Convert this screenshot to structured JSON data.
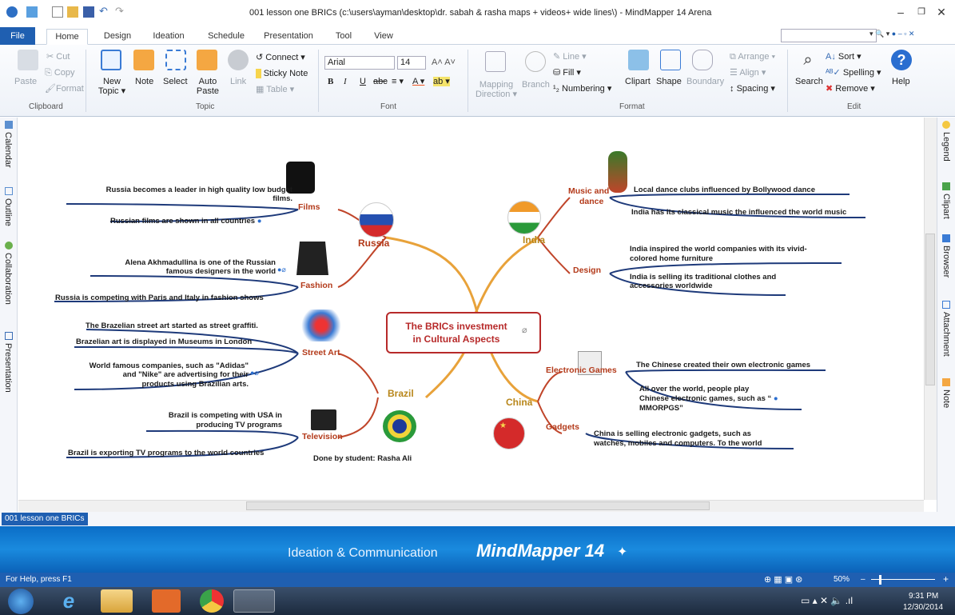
{
  "window": {
    "title": "001 lesson one BRICs (c:\\users\\ayman\\desktop\\dr. sabah & rasha maps + videos+ wide lines\\) - MindMapper 14 Arena"
  },
  "tabs": [
    "Home",
    "Design",
    "Ideation",
    "Schedule",
    "Presentation",
    "Tool",
    "View"
  ],
  "file_tab": "File",
  "ribbon": {
    "clipboard": {
      "paste": "Paste",
      "cut": "Cut",
      "copy": "Copy",
      "format": "Format",
      "label": "Clipboard"
    },
    "topic": {
      "new_topic": "New Topic ▾",
      "note": "Note",
      "select": "Select",
      "auto_paste": "Auto Paste",
      "link": "Link",
      "connect": "Connect ▾",
      "sticky_note": "Sticky Note",
      "table": "Table ▾",
      "label": "Topic"
    },
    "font": {
      "family": "Arial",
      "size": "14",
      "label": "Font"
    },
    "format": {
      "mapping_direction": "Mapping Direction ▾",
      "branch": "Branch",
      "line": "Line ▾",
      "fill": "Fill ▾",
      "numbering": "Numbering ▾",
      "clipart": "Clipart",
      "shape": "Shape",
      "boundary": "Boundary",
      "arrange": "Arrange ▾",
      "align": "Align ▾",
      "spacing": "Spacing ▾",
      "label": "Format"
    },
    "edit": {
      "search": "Search",
      "sort": "Sort ▾",
      "spelling": "Spelling ▾",
      "remove": "Remove ▾",
      "help": "Help",
      "label": "Edit"
    }
  },
  "left_sidebar": [
    "Calendar",
    "Outline",
    "Collaboration",
    "Presentation"
  ],
  "right_sidebar": [
    "Legend",
    "Clipart",
    "Browser",
    "Attachment",
    "Note"
  ],
  "mindmap": {
    "center": [
      "The BRICs investment",
      "in Cultural Aspects"
    ],
    "author": "Done by student: Rasha Ali",
    "russia": {
      "label": "Russia",
      "films": "Films",
      "films_1a": "Russia becomes a leader in high quality low budget",
      "films_1b": "films.",
      "films_2": "Russian films are shown in all countries",
      "fashion": "Fashion",
      "fashion_1a": "Alena Akhmadullina is one of the Russian",
      "fashion_1b": "famous designers in the world",
      "fashion_2": "Russia is competing with Paris and Italy in fashion shows"
    },
    "brazil": {
      "label": "Brazil",
      "street_art": "Street Art",
      "sa_1": "The Brazelian street art started as street graffiti.",
      "sa_2": "Brazelian art is displayed in Museums in London",
      "sa_3a": "World famous companies, such as \"Adidas\"",
      "sa_3b": "and \"Nike\" are advertising  for their",
      "sa_3c": "products using Brazilian arts.",
      "television": "Television",
      "tv_1a": "Brazil is competing with USA in",
      "tv_1b": "producing TV programs",
      "tv_2": "Brazil is exporting TV programs to the world countries"
    },
    "india": {
      "label": "India",
      "music": "Music and",
      "music2": "dance",
      "music_1": "Local dance clubs influenced by Bollywood dance",
      "music_2": "India has its classical music the influenced the world music",
      "design": "Design",
      "design_1a": "India inspired the world companies with its vivid-",
      "design_1b": "colored home furniture",
      "design_2a": "India is selling  its traditional clothes and",
      "design_2b": "accessories worldwide"
    },
    "china": {
      "label": "China",
      "games": "Electronic  Games",
      "games_1": "The Chinese created their own electronic games",
      "games_2a": "All over the world, people play",
      "games_2b": "Chinese electronic games, such as “",
      "games_2c": "MMORPGS”",
      "gadgets": "Gadgets",
      "gadgets_1a": "China is selling electronic gadgets, such as",
      "gadgets_1b": "watches, mobiles and computers. To the world"
    }
  },
  "sheet_tab": "001 lesson one BRICs",
  "banner": {
    "subtitle": "Ideation & Communication",
    "title": "MindMapper 14"
  },
  "status": {
    "help": "For Help, press F1",
    "zoom": "50%"
  },
  "clock": {
    "time": "9:31 PM",
    "date": "12/30/2014"
  }
}
